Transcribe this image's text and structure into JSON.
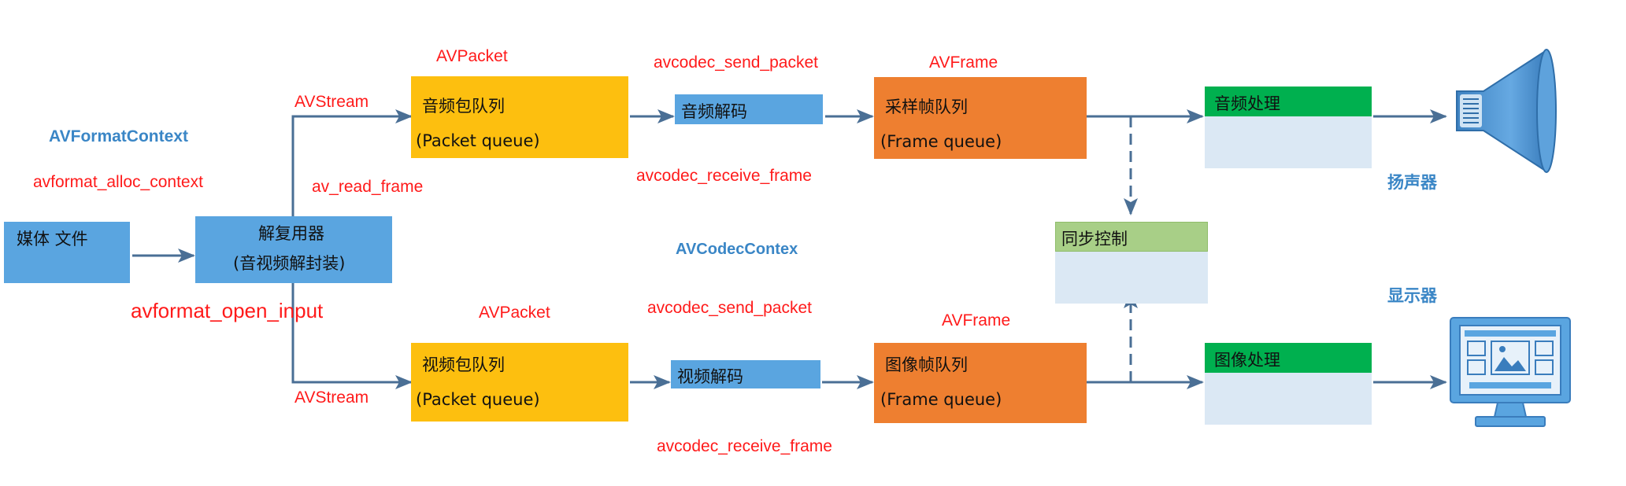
{
  "nodes": {
    "media_file": "媒体 文件",
    "demuxer": {
      "title": "解复用器",
      "subtitle": "(音视频解封装)"
    },
    "audio_packet_queue": {
      "title": "音频包队列",
      "subtitle": "(Packet queue)"
    },
    "video_packet_queue": {
      "title": "视频包队列",
      "subtitle": "(Packet queue)"
    },
    "audio_decode": "音频解码",
    "video_decode": "视频解码",
    "audio_frame_queue": {
      "title": "采样帧队列",
      "subtitle": "(Frame queue)"
    },
    "video_frame_queue": {
      "title": "图像帧队列",
      "subtitle": "(Frame queue)"
    },
    "audio_process": "音频处理",
    "image_process": "图像处理",
    "sync_control": "同步控制",
    "speaker": "扬声器",
    "display": "显示器"
  },
  "labels": {
    "avformat_context": "AVFormatContext",
    "avformat_alloc_context": "avformat_alloc_context",
    "avformat_open_input": "avformat_open_input",
    "av_read_frame": "av_read_frame",
    "avstream_top": "AVStream",
    "avstream_bottom": "AVStream",
    "avpacket_top": "AVPacket",
    "avpacket_bottom": "AVPacket",
    "avcodec_send_packet_top": "avcodec_send_packet",
    "avcodec_send_packet_bottom": "avcodec_send_packet",
    "avcodec_receive_frame_top": "avcodec_receive_frame",
    "avcodec_receive_frame_bottom": "avcodec_receive_frame",
    "avframe_top": "AVFrame",
    "avframe_bottom": "AVFrame",
    "avcodec_context": "AVCodecContex"
  },
  "colors": {
    "media_blue": "#5aa5e0",
    "queue_yellow": "#fdbf0f",
    "decode_blue": "#5aa5e0",
    "frame_orange": "#ee7f30",
    "process_green": "#00b04f",
    "sync_green": "#a8cf87",
    "pale_blue": "#dbe8f4",
    "arrow": "#4a6f95",
    "label_red": "#ff1a1a",
    "label_blue": "#3a86c6"
  },
  "icons": [
    "speaker-icon",
    "monitor-icon"
  ]
}
